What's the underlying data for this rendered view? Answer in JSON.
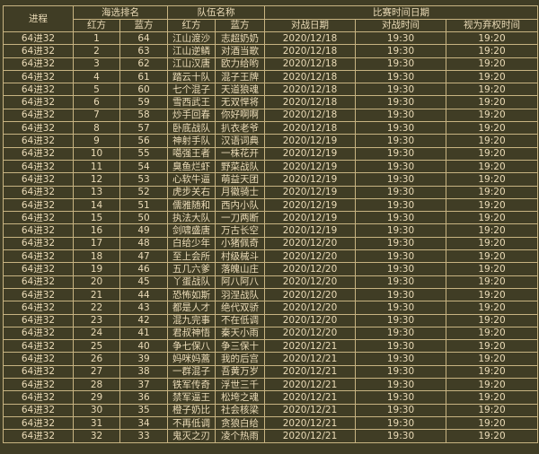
{
  "header": {
    "stage": "进程",
    "seed_group": "海选排名",
    "team_group": "队伍名称",
    "time_group": "比赛时间日期",
    "red": "红方",
    "blue": "蓝方",
    "red2": "红方",
    "blue2": "蓝方",
    "date": "对战日期",
    "time": "对战时间",
    "forfeit": "视为弃权时间"
  },
  "rows": [
    [
      "64进32",
      "1",
      "64",
      "江山渡沙",
      "志超奶奶",
      "2020/12/18",
      "19:30",
      "19:20"
    ],
    [
      "64进32",
      "2",
      "63",
      "江山逆鳞",
      "对酒当歌",
      "2020/12/18",
      "19:30",
      "19:20"
    ],
    [
      "64进32",
      "3",
      "62",
      "江山汉唐",
      "欧力给哟",
      "2020/12/18",
      "19:30",
      "19:20"
    ],
    [
      "64进32",
      "4",
      "61",
      "踏云十队",
      "混子王牌",
      "2020/12/18",
      "19:30",
      "19:20"
    ],
    [
      "64进32",
      "5",
      "60",
      "七个混子",
      "天道狼魂",
      "2020/12/18",
      "19:30",
      "19:20"
    ],
    [
      "64进32",
      "6",
      "59",
      "雪西武王",
      "无双悍将",
      "2020/12/18",
      "19:30",
      "19:20"
    ],
    [
      "64进32",
      "7",
      "58",
      "炒手回春",
      "你好啊啊",
      "2020/12/18",
      "19:30",
      "19:20"
    ],
    [
      "64进32",
      "8",
      "57",
      "卧底战队",
      "扒衣老爷",
      "2020/12/18",
      "19:30",
      "19:20"
    ],
    [
      "64进32",
      "9",
      "56",
      "神射手队",
      "汉语词典",
      "2020/12/19",
      "19:30",
      "19:20"
    ],
    [
      "64进32",
      "10",
      "55",
      "噶强王者",
      "一株花开",
      "2020/12/19",
      "19:30",
      "19:20"
    ],
    [
      "64进32",
      "11",
      "54",
      "臭鱼烂虾",
      "野菜战队",
      "2020/12/19",
      "19:30",
      "19:20"
    ],
    [
      "64进32",
      "12",
      "53",
      "心软牛逼",
      "萌益天团",
      "2020/12/19",
      "19:30",
      "19:20"
    ],
    [
      "64进32",
      "13",
      "52",
      "虎步关右",
      "月徽骑士",
      "2020/12/19",
      "19:30",
      "19:20"
    ],
    [
      "64进32",
      "14",
      "51",
      "儒雅随和",
      "西内小队",
      "2020/12/19",
      "19:30",
      "19:20"
    ],
    [
      "64进32",
      "15",
      "50",
      "执法大队",
      "一刀两断",
      "2020/12/19",
      "19:30",
      "19:20"
    ],
    [
      "64进32",
      "16",
      "49",
      "剑啸盛唐",
      "万古长空",
      "2020/12/19",
      "19:30",
      "19:20"
    ],
    [
      "64进32",
      "17",
      "48",
      "白给少年",
      "小猪佩奇",
      "2020/12/20",
      "19:30",
      "19:20"
    ],
    [
      "64进32",
      "18",
      "47",
      "至上会所",
      "村级械斗",
      "2020/12/20",
      "19:30",
      "19:20"
    ],
    [
      "64进32",
      "19",
      "46",
      "五几六爹",
      "落魄山庄",
      "2020/12/20",
      "19:30",
      "19:20"
    ],
    [
      "64进32",
      "20",
      "45",
      "丫蛋战队",
      "阿八阿八",
      "2020/12/20",
      "19:30",
      "19:20"
    ],
    [
      "64进32",
      "21",
      "44",
      "恐怖如斯",
      "羽涅战队",
      "2020/12/20",
      "19:30",
      "19:20"
    ],
    [
      "64进32",
      "22",
      "43",
      "都是人才",
      "绝代双骄",
      "2020/12/20",
      "19:30",
      "19:20"
    ],
    [
      "64进32",
      "23",
      "42",
      "混九完事",
      "不在低调",
      "2020/12/20",
      "19:30",
      "19:20"
    ],
    [
      "64进32",
      "24",
      "41",
      "君叔神悟",
      "秦天小雨",
      "2020/12/20",
      "19:30",
      "19:20"
    ],
    [
      "64进32",
      "25",
      "40",
      "争七保八",
      "争三保十",
      "2020/12/21",
      "19:30",
      "19:20"
    ],
    [
      "64进32",
      "26",
      "39",
      "妈咪妈蒿",
      "我的后宫",
      "2020/12/21",
      "19:30",
      "19:20"
    ],
    [
      "64进32",
      "27",
      "38",
      "一群混子",
      "吾黄万岁",
      "2020/12/21",
      "19:30",
      "19:20"
    ],
    [
      "64进32",
      "28",
      "37",
      "铁军传奇",
      "浮世三千",
      "2020/12/21",
      "19:30",
      "19:20"
    ],
    [
      "64进32",
      "29",
      "36",
      "禁军逼王",
      "松垮之魂",
      "2020/12/21",
      "19:30",
      "19:20"
    ],
    [
      "64进32",
      "30",
      "35",
      "橙子奶比",
      "社会核梁",
      "2020/12/21",
      "19:30",
      "19:20"
    ],
    [
      "64进32",
      "31",
      "34",
      "不再低调",
      "贪狼白给",
      "2020/12/21",
      "19:30",
      "19:20"
    ],
    [
      "64进32",
      "32",
      "33",
      "鬼灭之刃",
      "凌个热雨",
      "2020/12/21",
      "19:30",
      "19:20"
    ]
  ]
}
